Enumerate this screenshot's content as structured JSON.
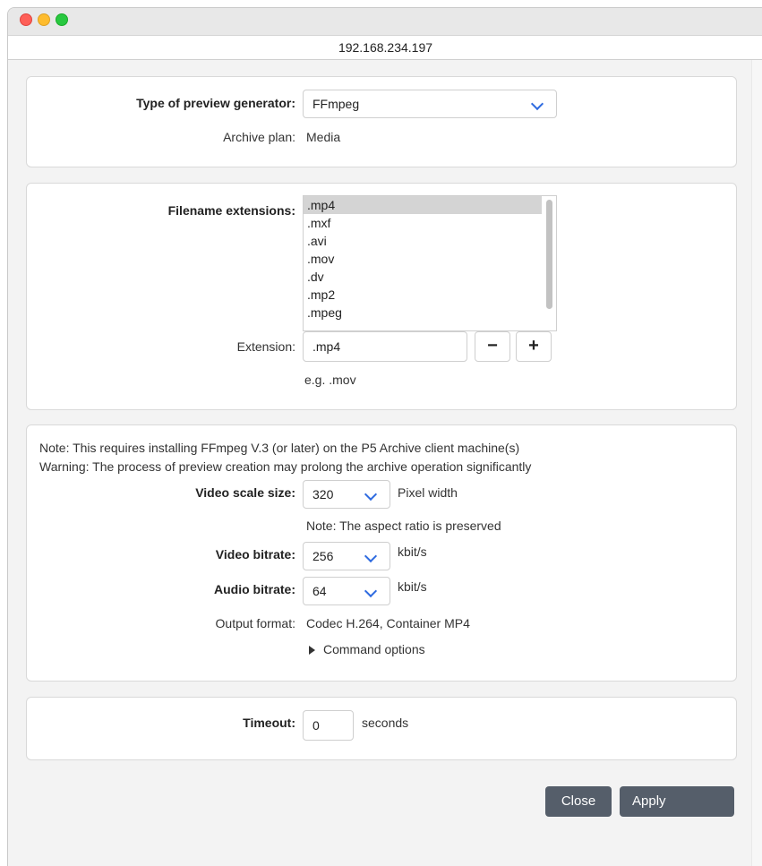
{
  "window": {
    "url": "192.168.234.197"
  },
  "generator": {
    "type_label": "Type of preview generator:",
    "type_value": "FFmpeg",
    "archive_plan_label": "Archive plan:",
    "archive_plan_value": "Media"
  },
  "extensions": {
    "label": "Filename extensions:",
    "items": [
      ".mp4",
      ".mxf",
      ".avi",
      ".mov",
      ".dv",
      ".mp2",
      ".mpeg"
    ],
    "selected": ".mp4",
    "extension_label": "Extension:",
    "extension_value": ".mp4",
    "remove_symbol": "−",
    "add_symbol": "+",
    "hint": "e.g. .mov"
  },
  "video": {
    "note": "Note: This requires installing FFmpeg V.3 (or later) on the P5 Archive client machine(s)",
    "warning": "Warning: The process of preview creation may prolong the archive operation significantly",
    "scale_label": "Video scale size:",
    "scale_value": "320",
    "scale_unit": "Pixel width",
    "aspect_note": "Note: The aspect ratio is preserved",
    "video_bitrate_label": "Video bitrate:",
    "video_bitrate_value": "256",
    "video_bitrate_unit": "kbit/s",
    "audio_bitrate_label": "Audio bitrate:",
    "audio_bitrate_value": "64",
    "audio_bitrate_unit": "kbit/s",
    "output_label": "Output format:",
    "output_value": "Codec H.264, Container MP4",
    "command_options_label": "Command options"
  },
  "timeout": {
    "label": "Timeout:",
    "value": "0",
    "unit": "seconds"
  },
  "buttons": {
    "close": "Close",
    "apply": "Apply"
  },
  "colors": {
    "accent": "#2f6be0",
    "button_bg": "#555e6a",
    "selected_row": "#d4d4d4"
  }
}
